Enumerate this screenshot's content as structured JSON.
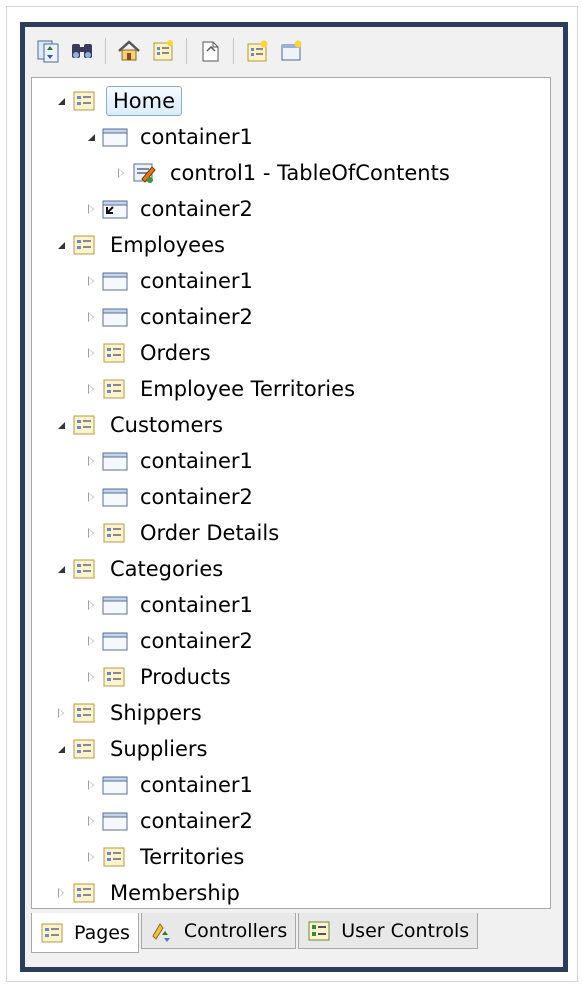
{
  "toolbar": {
    "buttons": [
      {
        "name": "sync-icon"
      },
      {
        "name": "find-icon"
      },
      {
        "name": "home-icon"
      },
      {
        "name": "page-properties-icon"
      },
      {
        "name": "new-page-icon"
      },
      {
        "name": "add-page-icon"
      },
      {
        "name": "add-container-icon"
      }
    ]
  },
  "tree": [
    {
      "label": "Home",
      "level": 0,
      "state": "expanded",
      "icon": "page-icon",
      "selected": true
    },
    {
      "label": "container1",
      "level": 1,
      "state": "expanded",
      "icon": "container-icon"
    },
    {
      "label": "control1 - TableOfContents",
      "level": 2,
      "state": "collapsed",
      "icon": "control-icon"
    },
    {
      "label": "container2",
      "level": 1,
      "state": "collapsed",
      "icon": "container-link-icon"
    },
    {
      "label": "Employees",
      "level": 0,
      "state": "expanded",
      "icon": "page-icon"
    },
    {
      "label": "container1",
      "level": 1,
      "state": "collapsed",
      "icon": "container-icon"
    },
    {
      "label": "container2",
      "level": 1,
      "state": "collapsed",
      "icon": "container-icon"
    },
    {
      "label": "Orders",
      "level": 1,
      "state": "collapsed",
      "icon": "page-icon"
    },
    {
      "label": "Employee Territories",
      "level": 1,
      "state": "collapsed",
      "icon": "page-icon"
    },
    {
      "label": "Customers",
      "level": 0,
      "state": "expanded",
      "icon": "page-icon"
    },
    {
      "label": "container1",
      "level": 1,
      "state": "collapsed",
      "icon": "container-icon"
    },
    {
      "label": "container2",
      "level": 1,
      "state": "collapsed",
      "icon": "container-icon"
    },
    {
      "label": "Order Details",
      "level": 1,
      "state": "collapsed",
      "icon": "page-icon"
    },
    {
      "label": "Categories",
      "level": 0,
      "state": "expanded",
      "icon": "page-icon"
    },
    {
      "label": "container1",
      "level": 1,
      "state": "collapsed",
      "icon": "container-icon"
    },
    {
      "label": "container2",
      "level": 1,
      "state": "collapsed",
      "icon": "container-icon"
    },
    {
      "label": "Products",
      "level": 1,
      "state": "collapsed",
      "icon": "page-icon"
    },
    {
      "label": "Shippers",
      "level": 0,
      "state": "collapsed",
      "icon": "page-icon"
    },
    {
      "label": "Suppliers",
      "level": 0,
      "state": "expanded",
      "icon": "page-icon"
    },
    {
      "label": "container1",
      "level": 1,
      "state": "collapsed",
      "icon": "container-icon"
    },
    {
      "label": "container2",
      "level": 1,
      "state": "collapsed",
      "icon": "container-icon"
    },
    {
      "label": "Territories",
      "level": 1,
      "state": "collapsed",
      "icon": "page-icon"
    },
    {
      "label": "Membership",
      "level": 0,
      "state": "collapsed",
      "icon": "page-icon"
    }
  ],
  "tabs": [
    {
      "label": "Pages",
      "icon": "page-icon",
      "active": true
    },
    {
      "label": "Controllers",
      "icon": "controller-icon",
      "active": false
    },
    {
      "label": "User Controls",
      "icon": "user-control-icon",
      "active": false
    }
  ],
  "colors": {
    "frame": "#2c3c5c",
    "selection_border": "#84acdd"
  }
}
